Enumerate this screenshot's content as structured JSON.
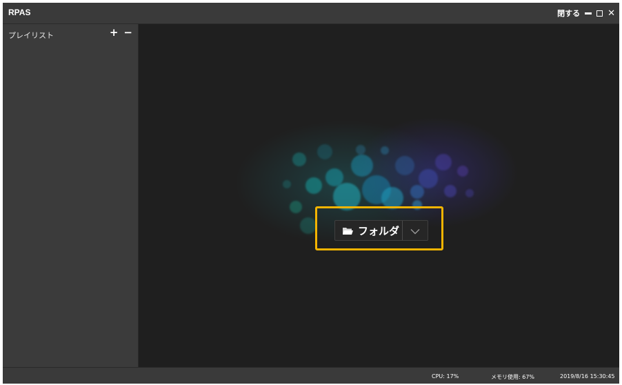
{
  "window": {
    "title": "RPAS",
    "close_label": "閉する"
  },
  "sidebar": {
    "title": "プレイリスト",
    "add_label": "+",
    "remove_label": "−"
  },
  "main": {
    "folder_button": {
      "label": "フォルダ",
      "icon": "folder-icon",
      "dropdown_icon": "chevron-down-icon"
    },
    "highlight_color": "#f4b400"
  },
  "statusbar": {
    "cpu": "CPU: 17%",
    "memory": "メモリ使用: 67%",
    "datetime": "2019/8/16 15:30:45"
  }
}
